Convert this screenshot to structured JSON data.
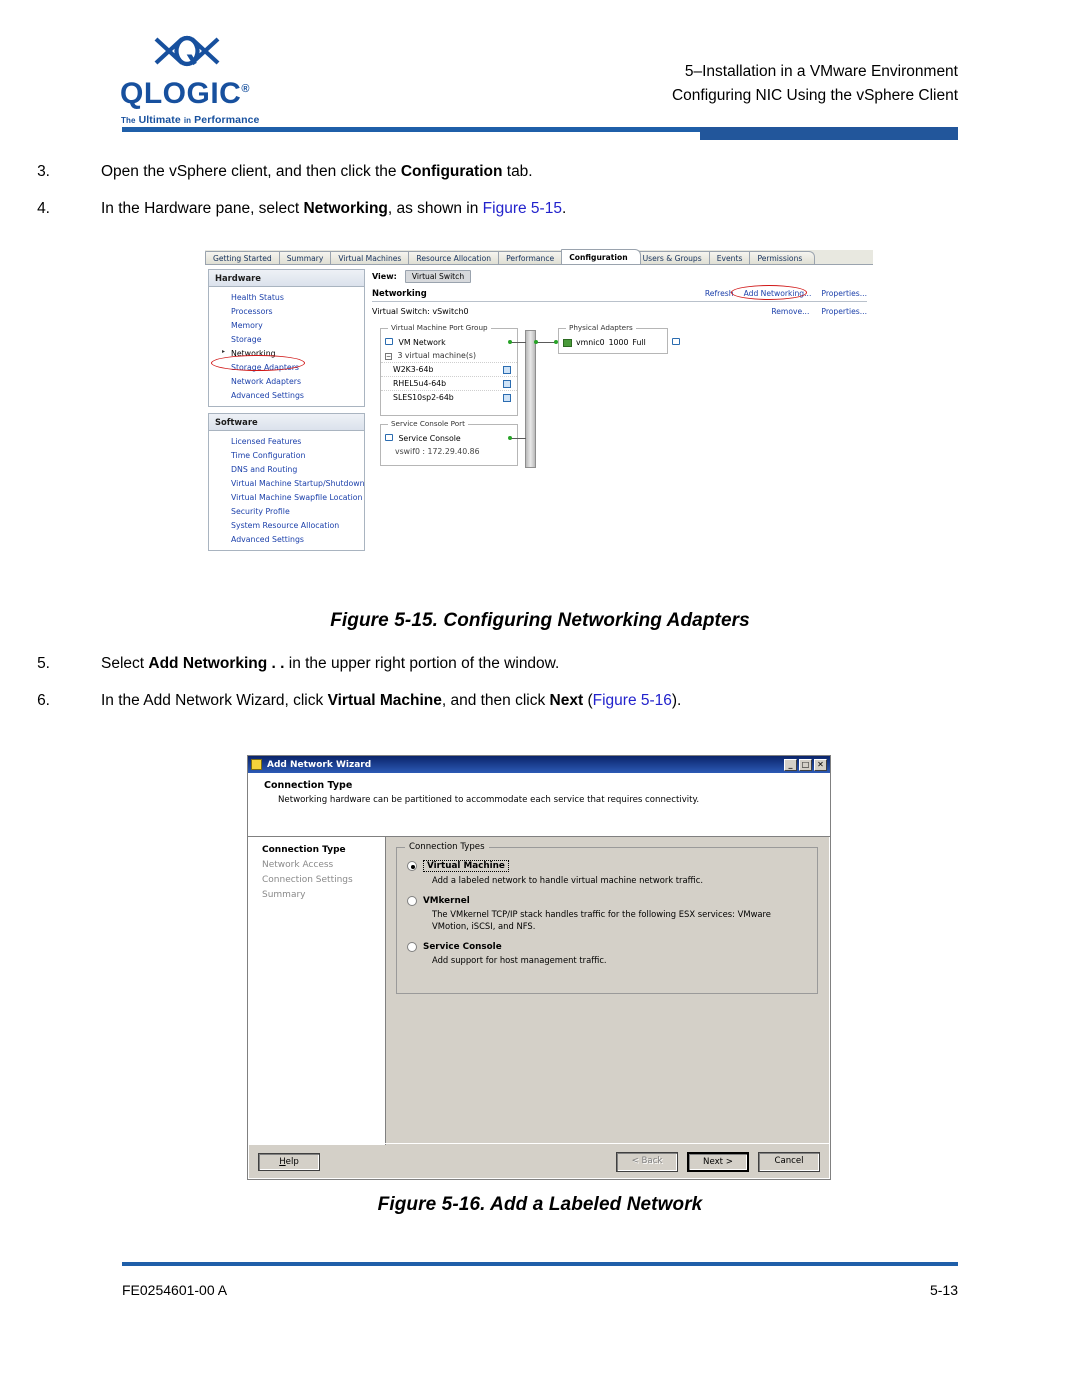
{
  "header": {
    "logo_word": "QLOGIC",
    "logo_tagline_1": "The",
    "logo_tagline_2": "Ultimate",
    "logo_tagline_3": "in",
    "logo_tagline_4": "Performance",
    "line1": "5–Installation in a VMware Environment",
    "line2": "Configuring NIC Using the vSphere Client"
  },
  "steps": [
    {
      "num": "3.",
      "parts": [
        {
          "t": "Open the vSphere client, and then click the ",
          "b": false
        },
        {
          "t": "Configuration",
          "b": true
        },
        {
          "t": " tab.",
          "b": false
        }
      ]
    },
    {
      "num": "4.",
      "parts": [
        {
          "t": "In the Hardware pane, select ",
          "b": false
        },
        {
          "t": "Networking",
          "b": true
        },
        {
          "t": ", as shown in ",
          "b": false
        },
        {
          "t": "Figure 5-15",
          "b": false,
          "link": true
        },
        {
          "t": ".",
          "b": false
        }
      ]
    },
    {
      "num": "5.",
      "parts": [
        {
          "t": "Select ",
          "b": false
        },
        {
          "t": "Add Networking . .",
          "b": true
        },
        {
          "t": " in the upper right portion of the window.",
          "b": false
        }
      ]
    },
    {
      "num": "6.",
      "parts": [
        {
          "t": "In the Add Network Wizard, click ",
          "b": false
        },
        {
          "t": "Virtual Machine",
          "b": true
        },
        {
          "t": ", and then click ",
          "b": false
        },
        {
          "t": "Next",
          "b": true
        },
        {
          "t": " (",
          "b": false
        },
        {
          "t": "Figure 5-16",
          "b": false,
          "link": true
        },
        {
          "t": ").",
          "b": false
        }
      ]
    }
  ],
  "figure_15": {
    "caption": "Figure 5-15. Configuring Networking Adapters",
    "tabs": [
      {
        "label": "Getting Started",
        "active": false
      },
      {
        "label": "Summary",
        "active": false
      },
      {
        "label": "Virtual Machines",
        "active": false
      },
      {
        "label": "Resource Allocation",
        "active": false
      },
      {
        "label": "Performance",
        "active": false
      },
      {
        "label": "Configuration",
        "active": true
      },
      {
        "label": "Users & Groups",
        "active": false
      },
      {
        "label": "Events",
        "active": false
      },
      {
        "label": "Permissions",
        "active": false
      }
    ],
    "hardware_panel": {
      "title": "Hardware",
      "items": [
        {
          "label": "Health Status",
          "selected": false
        },
        {
          "label": "Processors",
          "selected": false
        },
        {
          "label": "Memory",
          "selected": false
        },
        {
          "label": "Storage",
          "selected": false
        },
        {
          "label": "Networking",
          "selected": true
        },
        {
          "label": "Storage Adapters",
          "selected": false
        },
        {
          "label": "Network Adapters",
          "selected": false
        },
        {
          "label": "Advanced Settings",
          "selected": false
        }
      ]
    },
    "software_panel": {
      "title": "Software",
      "items": [
        {
          "label": "Licensed Features"
        },
        {
          "label": "Time Configuration"
        },
        {
          "label": "DNS and Routing"
        },
        {
          "label": "Virtual Machine Startup/Shutdown"
        },
        {
          "label": "Virtual Machine Swapfile Location"
        },
        {
          "label": "Security Profile"
        },
        {
          "label": "System Resource Allocation"
        },
        {
          "label": "Advanced Settings"
        }
      ]
    },
    "view_label": "View:",
    "view_value": "Virtual Switch",
    "networking_title": "Networking",
    "top_links": [
      "Refresh",
      "Add Networking...",
      "Properties..."
    ],
    "switch_name": "Virtual Switch: vSwitch0",
    "switch_links": [
      "Remove...",
      "Properties..."
    ],
    "vm_port_group_legend": "Virtual Machine Port Group",
    "vm_network_label": "VM Network",
    "vm_count_label": "3 virtual machine(s)",
    "vms": [
      "W2K3-64b",
      "RHEL5u4-64b",
      "SLES10sp2-64b"
    ],
    "service_console_legend": "Service Console Port",
    "service_console_label": "Service Console",
    "service_console_ip": "vswif0 : 172.29.40.86",
    "physical_adapters_legend": "Physical Adapters",
    "physical_adapter": {
      "name": "vmnic0",
      "speed": "1000",
      "duplex": "Full"
    },
    "annotation_color": "#D01717"
  },
  "figure_16": {
    "caption": "Figure 5-16. Add a Labeled Network",
    "window_title": "Add Network Wizard",
    "window_buttons": [
      "_",
      "□",
      "✕"
    ],
    "head_title": "Connection Type",
    "head_desc": "Networking hardware can be partitioned to accommodate each service that requires connectivity.",
    "nav": [
      {
        "label": "Connection Type",
        "current": true
      },
      {
        "label": "Network Access",
        "current": false
      },
      {
        "label": "Connection Settings",
        "current": false
      },
      {
        "label": "Summary",
        "current": false
      }
    ],
    "fieldset_legend": "Connection Types",
    "options": [
      {
        "label": "Virtual Machine",
        "selected": true,
        "desc": "Add a labeled network to handle virtual machine network traffic."
      },
      {
        "label": "VMkernel",
        "selected": false,
        "desc": "The VMkernel TCP/IP stack handles traffic for the following ESX services: VMware VMotion, iSCSI, and NFS."
      },
      {
        "label": "Service Console",
        "selected": false,
        "desc": "Add support for host management traffic."
      }
    ],
    "buttons": {
      "help": "Help",
      "back": "< Back",
      "next": "Next >",
      "cancel": "Cancel"
    }
  },
  "footer": {
    "doc_number": "FE0254601-00 A",
    "page_number": "5-13"
  }
}
